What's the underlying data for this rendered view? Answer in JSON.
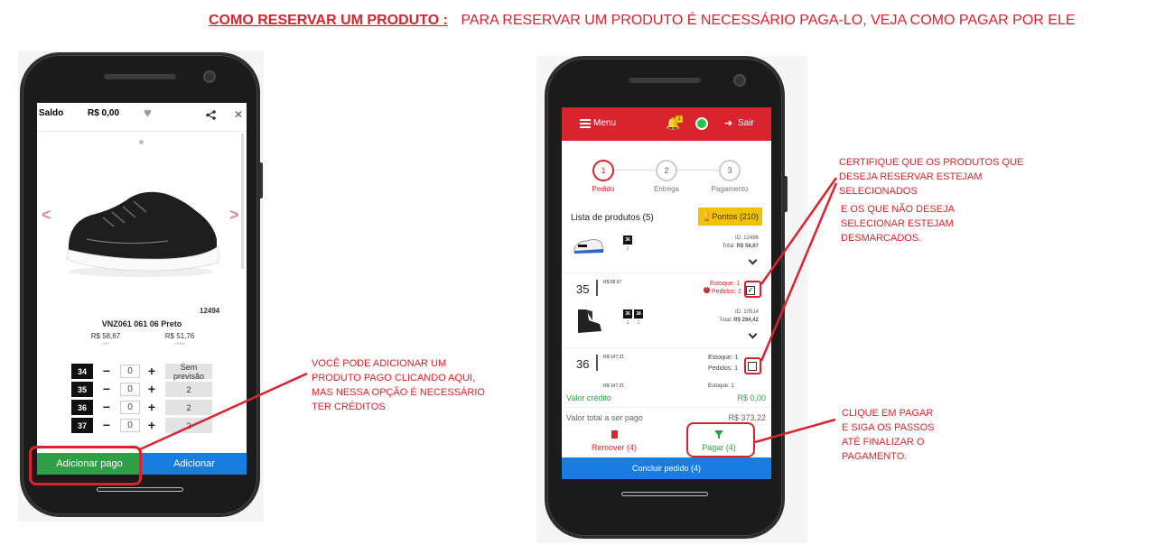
{
  "title": {
    "main": "COMO RESERVAR UM PRODUTO :",
    "sub": "PARA RESERVAR UM PRODUTO É NECESSÁRIO PAGA-LO, VEJA COMO PAGAR POR ELE"
  },
  "left_phone": {
    "header": {
      "saldo_label": "Saldo",
      "saldo_value": "R$ 0,00"
    },
    "product": {
      "code": "12494",
      "name": "VNZ061 061 06 Preto",
      "price1": "R$ 58,67",
      "price1_sub": "UPP",
      "price2": "R$ 51,76",
      "price2_sub": "CRMS"
    },
    "sizes": [
      {
        "size": "34",
        "qty": "0",
        "stock": "Sem previsão"
      },
      {
        "size": "35",
        "qty": "0",
        "stock": "2"
      },
      {
        "size": "36",
        "qty": "0",
        "stock": "2"
      },
      {
        "size": "37",
        "qty": "0",
        "stock": "2"
      }
    ],
    "minus": "−",
    "plus": "+",
    "btn_paid": "Adicionar pago",
    "btn_add": "Adicionar",
    "arrow_left": "<",
    "arrow_right": ">"
  },
  "left_note": "VOCÊ PODE ADICIONAR UM PRODUTO PAGO CLICANDO AQUI, MAS NESSA OPÇÃO É NECESSÁRIO TER CRÉDITOS",
  "right_phone": {
    "menu": "Menu",
    "notif_count": "1",
    "exit": "Sair",
    "steps": [
      {
        "num": "1",
        "label": "Pedido"
      },
      {
        "num": "2",
        "label": "Entrega"
      },
      {
        "num": "3",
        "label": "Pagamento"
      }
    ],
    "list_title": "Lista de produtos (5)",
    "points": "Pontos (210)",
    "items": [
      {
        "id": "ID: 12496",
        "total_label": "Total:",
        "total": "R$ 58,67",
        "sizes": [
          "36"
        ],
        "qty": [
          "1"
        ],
        "size_big": "35",
        "price": "R$ 58,67",
        "stock": "Estoque: 1",
        "orders": "Pedidos: 2"
      },
      {
        "id": "ID: 10514",
        "total_label": "Total:",
        "total": "R$ 294,42",
        "sizes": [
          "36",
          "38"
        ],
        "qty": [
          "1",
          "1"
        ],
        "size_big": "36",
        "price": "R$ 147,21",
        "stock": "Estoque: 1",
        "orders": "Pedidos: 1"
      }
    ],
    "partial_price": "R$ 147,21",
    "partial_stock": "Estoque: 1",
    "credit_label": "Valor crédito",
    "credit_value": "R$ 0,00",
    "total_label": "Valor total a ser pago",
    "total_value": "R$ 373,22",
    "remove": "Remover (4)",
    "pay": "Pagar (4)",
    "finish": "Concluir pedido (4)"
  },
  "right_notes": {
    "n1": [
      "CERTIFIQUE QUE OS PRODUTOS QUE",
      "DESEJA RESERVAR ESTEJAM",
      "SELECIONADOS"
    ],
    "n2": [
      "E OS QUE NÃO DESEJA",
      "SELECIONAR ESTEJAM",
      "DESMARCADOS."
    ],
    "n3": [
      "CLIQUE EM PAGAR",
      "E SIGA OS PASSOS",
      "ATÉ FINALIZAR O",
      "PAGAMENTO."
    ]
  },
  "colors": {
    "accent": "#d9232e",
    "green": "#2e9e47",
    "blue": "#1a7be0",
    "yellow": "#f2c200"
  }
}
